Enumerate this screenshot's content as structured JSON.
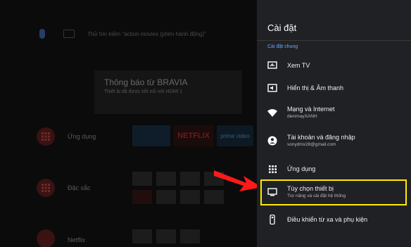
{
  "background": {
    "search_hint": "Thử tìm kiếm \"action movies (phim hành động)\"",
    "notification": {
      "title": "Thông báo từ BRAVIA",
      "subtitle": "Thiết bị đã được kết nối với HDMI 1"
    },
    "rows": [
      {
        "label": "Ứng dụng"
      },
      {
        "label": "Đặc sắc"
      },
      {
        "label": "Netflix"
      }
    ],
    "tiles": {
      "netflix": "NETFLIX",
      "prime": "prime video"
    }
  },
  "settings": {
    "title": "Cài đặt",
    "section": "Cài đặt chung",
    "items": [
      {
        "label": "Xem TV",
        "sub": "",
        "icon": "tv-input-icon"
      },
      {
        "label": "Hiển thị & Âm thanh",
        "sub": "",
        "icon": "display-sound-icon"
      },
      {
        "label": "Mạng và Internet",
        "sub": "dienmayXANH",
        "icon": "wifi-icon"
      },
      {
        "label": "Tài khoản và đăng nhập",
        "sub": "sonydmx28@gmail.com",
        "icon": "account-icon"
      },
      {
        "label": "Ứng dụng",
        "sub": "",
        "icon": "apps-grid-icon"
      },
      {
        "label": "Tùy chọn thiết bị",
        "sub": "Trợ năng và cài đặt hệ thống",
        "icon": "monitor-icon"
      },
      {
        "label": "Điều khiển từ xa và phụ kiện",
        "sub": "",
        "icon": "remote-icon"
      }
    ]
  },
  "colors": {
    "panel": "#202124",
    "accent": "#6fa8ff",
    "highlight": "#ffea00",
    "arrow": "#ff1a1a"
  }
}
